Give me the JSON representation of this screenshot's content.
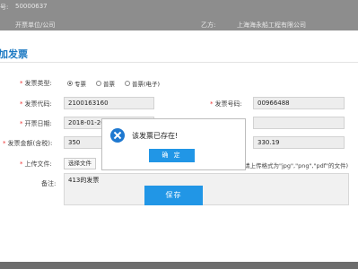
{
  "background": {
    "top_left": "号:",
    "top_number": "50000637",
    "row2_left": "开票单位/公司",
    "row2_mid": "乙方:",
    "row2_right": "上海海永船工程有限公司"
  },
  "panel": {
    "title": "加发票"
  },
  "form": {
    "invoice_type": {
      "label": "发票类型:",
      "options": [
        "专票",
        "普票",
        "普票(电子)"
      ],
      "selected_index": 0
    },
    "invoice_code": {
      "label": "发票代码:",
      "value": "2100163160"
    },
    "invoice_number": {
      "label": "发票号码:",
      "value": "00966488"
    },
    "invoice_date": {
      "label": "开票日期:",
      "value": "2018-01-26"
    },
    "amount_with_tax": {
      "label": "发票金额(含税):",
      "value": "350"
    },
    "amount_right": {
      "value": "330.19"
    },
    "upload": {
      "label": "上传文件:",
      "button": "选择文件",
      "hint": "请上传格式为\"jpg\",\"png\",\"pdf\"的文件)"
    },
    "remarks": {
      "label": "备注:",
      "value": "413的发票"
    }
  },
  "buttons": {
    "save": "保存"
  },
  "dialog": {
    "message": "该发票已存在!",
    "confirm": "确 定"
  },
  "colors": {
    "accent": "#2196e6",
    "title": "#1a78c2",
    "required": "#e33333",
    "overlay": "#7f7f7f"
  }
}
